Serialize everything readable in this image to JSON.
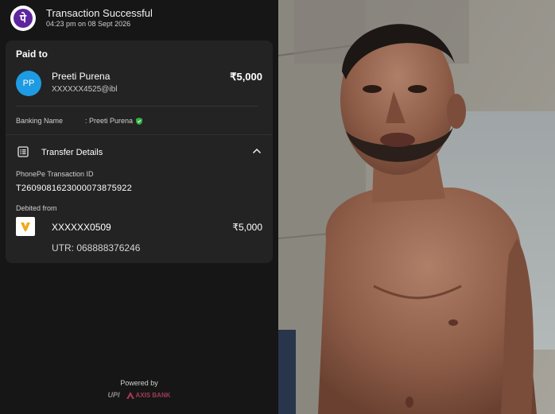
{
  "header": {
    "logo_glyph": "पे",
    "title": "Transaction Successful",
    "subtitle": "04:23 pm on 08 Sept 2026"
  },
  "card": {
    "paid_to_label": "Paid to",
    "payee": {
      "initials": "PP",
      "name": "Preeti  Purena",
      "upi_id": "XXXXXX4525@ibl",
      "amount": "₹5,000"
    },
    "banking_name_label": "Banking Name",
    "banking_name_value": ":  Preeti  Purena",
    "transfer_details": {
      "label": "Transfer Details",
      "txn_id_label": "PhonePe Transaction ID",
      "txn_id": "T2609081623000073875922",
      "debited_from_label": "Debited from",
      "account": "XXXXXX0509",
      "amount": "₹5,000",
      "utr": "UTR: 068888376246"
    }
  },
  "footer": {
    "powered_by": "Powered by",
    "upi_label": "UPI",
    "bank_label": "AXIS BANK"
  },
  "colors": {
    "phonepe_purple": "#5f259f",
    "avatar_blue": "#1e9be2",
    "verified_green": "#2fb344",
    "axis_maroon": "#a03a56"
  }
}
